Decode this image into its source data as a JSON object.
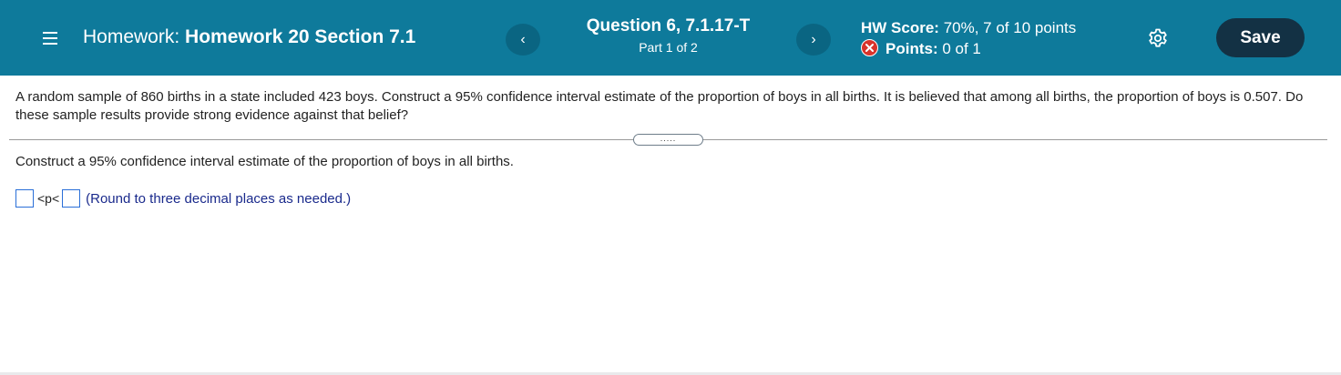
{
  "header": {
    "homework_prefix": "Homework:",
    "homework_name": "Homework 20 Section 7.1",
    "question_title": "Question 6, 7.1.17-T",
    "part_label": "Part 1 of 2",
    "prev_label": "‹",
    "next_label": "›",
    "hw_score_label": "HW Score:",
    "hw_score_value": "70%, 7 of 10 points",
    "points_label": "Points:",
    "points_value": "0 of 1",
    "save_label": "Save"
  },
  "icons": {
    "menu": "menu-icon",
    "incorrect": "x-circle-icon",
    "settings": "gear-icon"
  },
  "colors": {
    "header_bg": "#0e7a9b",
    "save_bg": "#133144",
    "incorrect_red": "#d9342b",
    "input_border": "#2a6fd8",
    "note_blue": "#1a2a8c"
  },
  "question": {
    "text": "A random sample of 860 births in a state included 423 boys. Construct a 95% confidence interval estimate of the proportion of boys in all births. It is believed that among all births, the proportion of boys is 0.507. Do these sample results provide strong evidence against that belief?",
    "expand_label": "....."
  },
  "part": {
    "instruction": "Construct a 95% confidence interval estimate of the proportion of boys in all births.",
    "inequality": "<p<",
    "lower_value": "",
    "upper_value": "",
    "round_note": "(Round to three decimal places as needed.)"
  }
}
